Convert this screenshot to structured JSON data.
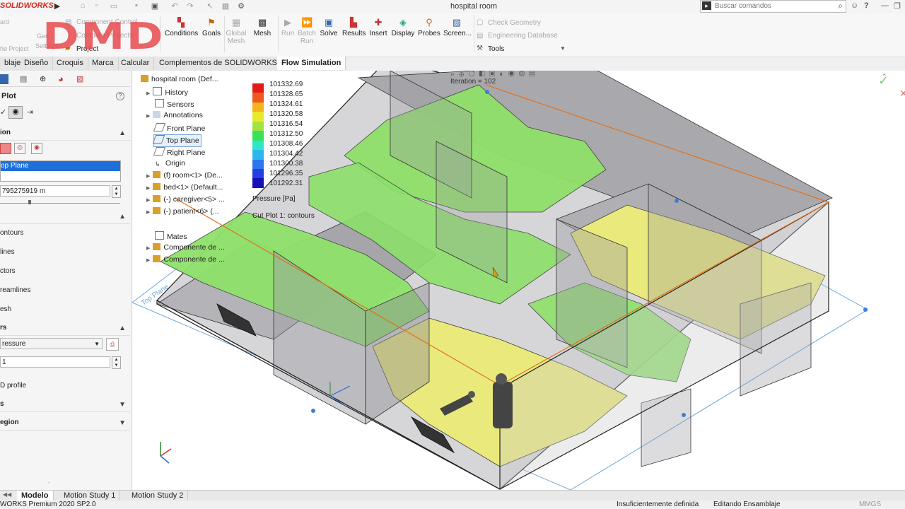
{
  "titlebar": {
    "app_logo": "SOLIDWORKS",
    "doc_title": "hospital room",
    "search_placeholder": "Buscar comandos",
    "help_label": "?"
  },
  "command_manager": {
    "left_items": [
      "ard",
      "Gen",
      "Settings",
      "he Project"
    ],
    "component_control": "Component Control",
    "compare": "Compare Projects",
    "project": "Project",
    "conditions": "Conditions",
    "goals": "Goals",
    "global_mesh": "Global Mesh",
    "mesh": "Mesh",
    "run": "Run",
    "batch_run": "Batch Run",
    "solve": "Solve",
    "results": "Results",
    "insert": "Insert",
    "display": "Display",
    "probes": "Probes",
    "screen": "Screen...",
    "check_geometry": "Check Geometry",
    "engineering_database": "Engineering Database",
    "tools": "Tools"
  },
  "watermark": "DMD",
  "tabs": [
    "blaje",
    "Diseño",
    "Croquis",
    "Marca",
    "Calcular",
    "Complementos de SOLIDWORKS",
    "Flow Simulation"
  ],
  "active_tab": "Flow Simulation",
  "property_manager": {
    "title": "Plot",
    "help": "?",
    "section_selection": "ion",
    "selected_plane": "op Plane",
    "offset_value": "795275919 m",
    "options": [
      "ontours",
      "lines",
      "ctors",
      "reamlines",
      "esh"
    ],
    "section_contours": "rs",
    "parameter": "ressure",
    "levels": "1",
    "profile_label": "D profile",
    "section_s": "s",
    "section_region": "egion"
  },
  "feature_tree": {
    "root": "hospital room  (Def...",
    "items": [
      "History",
      "Sensors",
      "Annotations",
      "Front Plane",
      "Top Plane",
      "Right Plane",
      "Origin",
      "(f) room<1> (De...",
      "bed<1> (Default...",
      "(-) caregiver<5> ...",
      "(-) patient<6> (...",
      "Mates",
      "Componente de ...",
      "Componente de ..."
    ]
  },
  "legend": {
    "values": [
      "101332.69",
      "101328.65",
      "101324.61",
      "101320.58",
      "101316.54",
      "101312.50",
      "101308.46",
      "101304.42",
      "101300.38",
      "101296.35",
      "101292.31"
    ],
    "colors": [
      "#e11b16",
      "#f0581f",
      "#f4b31f",
      "#e8e92b",
      "#a2e243",
      "#38e35b",
      "#2fe6c9",
      "#2cb7ee",
      "#2d76ed",
      "#2440e0",
      "#1610b9"
    ],
    "parameter": "Pressure [Pa]",
    "plot_name": "Cut Plot 1: contours"
  },
  "viewport": {
    "iteration": "Iteration = 102",
    "plane_label": "Top Plane"
  },
  "bottom_tabs": [
    "Modelo",
    "Motion Study 1",
    "Motion Study 2"
  ],
  "active_bottom_tab": "Modelo",
  "status": {
    "version": "WORKS Premium 2020 SP2.0",
    "definition": "Insuficientemente definida",
    "mode": "Editando Ensamblaje",
    "units": "MMGS"
  }
}
